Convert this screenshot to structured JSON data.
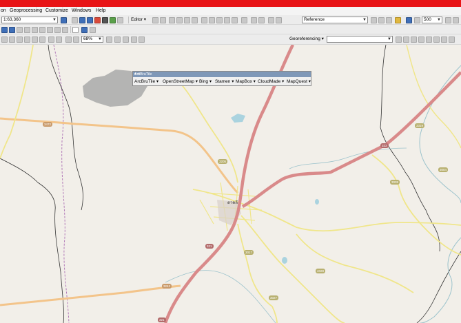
{
  "menu": [
    "on",
    "Geoprocessing",
    "Customize",
    "Windows",
    "Help"
  ],
  "toolbar": {
    "scale_value": "1:63,360",
    "editor_label": "Editor ▾",
    "layer_value": "Reference",
    "zoom_value": "500",
    "zoom_percent": "68%",
    "georeferencing_label": "Georeferencing ▾"
  },
  "arcbrutile": {
    "title": "ArcBruTile",
    "providers": [
      "ArcBruTile ▾",
      "OpenStreetMap ▾",
      "Bing ▾",
      "Stamen ▾",
      "MapBox ▾",
      "CloudMade ▾",
      "MapQuest ▾"
    ]
  },
  "map": {
    "town_label": "ตาคลี",
    "road_labels": [
      "3472",
      "3205",
      "3319",
      "323",
      "3038",
      "3004",
      "321",
      "3017",
      "4028",
      "3242",
      "3027",
      "321"
    ]
  },
  "colors": {
    "title_bar": "#e81416",
    "main_road": "#d98a8a",
    "secondary_road": "#f3c48a",
    "minor_road": "#f0e68a",
    "boundary": "#333333",
    "province_boundary": "#b27ab8",
    "water": "#aad3df",
    "urban_gray": "#a9a9a9"
  }
}
